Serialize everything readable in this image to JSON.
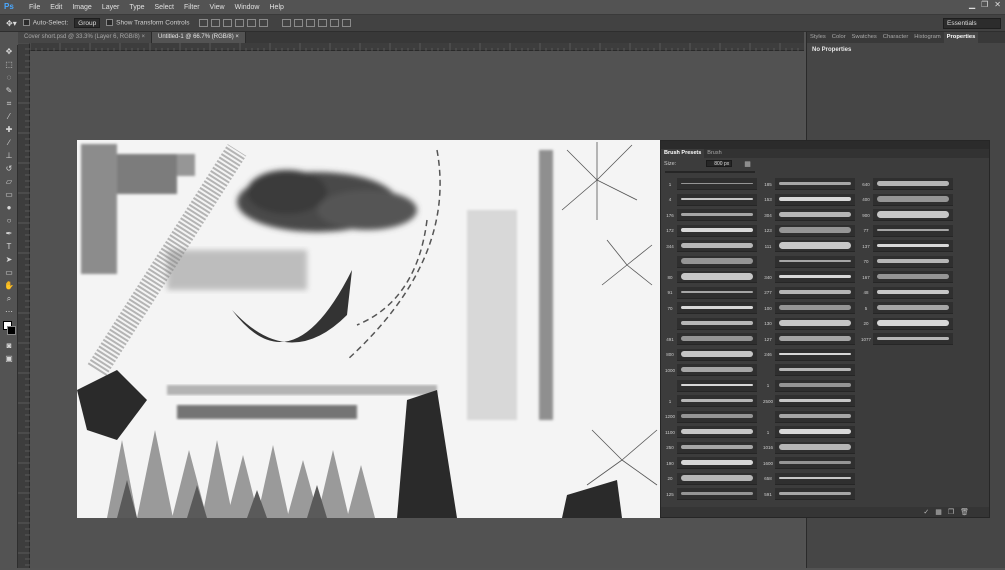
{
  "app": {
    "logo": "Ps",
    "menu": [
      "File",
      "Edit",
      "Image",
      "Layer",
      "Type",
      "Select",
      "Filter",
      "View",
      "Window",
      "Help"
    ],
    "window_controls": [
      "▁",
      "❐",
      "✕"
    ]
  },
  "options_bar": {
    "auto_select_label": "Auto-Select:",
    "auto_select_value": "Group",
    "show_transform_label": "Show Transform Controls",
    "workspace": "Essentials"
  },
  "documents": {
    "tabs": [
      {
        "label": "Cover short.psd @ 33.3% (Layer 6, RGB/8) ×"
      },
      {
        "label": "Untitled-1 @ 66.7% (RGB/8) ×"
      }
    ],
    "active_index": 1
  },
  "tools": [
    "move-tool",
    "marquee-tool",
    "lasso-tool",
    "quick-select-tool",
    "crop-tool",
    "eyedropper-tool",
    "healing-tool",
    "brush-tool",
    "stamp-tool",
    "history-brush-tool",
    "eraser-tool",
    "gradient-tool",
    "blur-tool",
    "dodge-tool",
    "pen-tool",
    "type-tool",
    "path-select-tool",
    "shape-tool",
    "hand-tool",
    "zoom-tool"
  ],
  "right_panel": {
    "tabs": [
      "Styles",
      "Color",
      "Swatches",
      "Character",
      "Histogram",
      "Properties"
    ],
    "active_tab": "Properties",
    "content": "No Properties"
  },
  "brush_panel": {
    "tabs": [
      "Brush Presets",
      "Brush"
    ],
    "active_tab": "Brush Presets",
    "size_label": "Size:",
    "size_value": "800 px",
    "columns": [
      {
        "nums": [
          "1",
          "4",
          "176",
          "172",
          "344",
          "",
          "80",
          "91",
          "70",
          "",
          "491",
          "800",
          "1000",
          "",
          "1",
          "1200",
          "1100",
          "250",
          "190",
          "20",
          "125"
        ]
      },
      {
        "nums": [
          "185",
          "153",
          "304",
          "123",
          "111",
          "",
          "340",
          "277",
          "100",
          "130",
          "127",
          "246",
          "",
          "1",
          "2500",
          "",
          "1",
          "1016",
          "1600",
          "658",
          "591"
        ]
      },
      {
        "nums": [
          "640",
          "400",
          "900",
          "77",
          "137",
          "70",
          "167",
          "48",
          "5",
          "20",
          "1077"
        ]
      }
    ]
  }
}
